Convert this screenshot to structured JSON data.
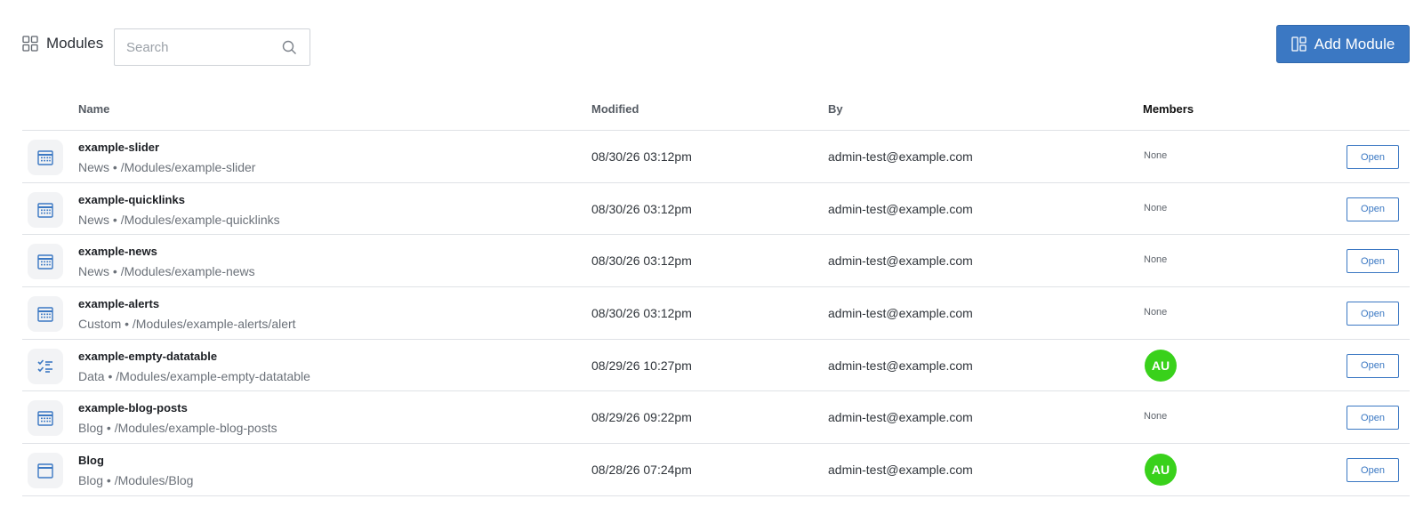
{
  "header": {
    "title": "Modules",
    "search_placeholder": "Search",
    "search_value": "",
    "add_button_label": "Add Module",
    "accent_color": "#3b78c3"
  },
  "table": {
    "columns": {
      "name": "Name",
      "modified": "Modified",
      "by": "By",
      "members": "Members"
    },
    "open_label": "Open",
    "rows": [
      {
        "name": "example-slider",
        "type": "News",
        "path": "/Modules/example-slider",
        "modified": "08/30/26 03:12pm",
        "by": "admin-test@example.com",
        "members": "None",
        "icon": "calendar-grid-icon"
      },
      {
        "name": "example-quicklinks",
        "type": "News",
        "path": "/Modules/example-quicklinks",
        "modified": "08/30/26 03:12pm",
        "by": "admin-test@example.com",
        "members": "None",
        "icon": "calendar-grid-icon"
      },
      {
        "name": "example-news",
        "type": "News",
        "path": "/Modules/example-news",
        "modified": "08/30/26 03:12pm",
        "by": "admin-test@example.com",
        "members": "None",
        "icon": "calendar-grid-icon"
      },
      {
        "name": "example-alerts",
        "type": "Custom",
        "path": "/Modules/example-alerts/alert",
        "modified": "08/30/26 03:12pm",
        "by": "admin-test@example.com",
        "members": "None",
        "icon": "calendar-grid-icon"
      },
      {
        "name": "example-empty-datatable",
        "type": "Data",
        "path": "/Modules/example-empty-datatable",
        "modified": "08/29/26 10:27pm",
        "by": "admin-test@example.com",
        "members": "AU",
        "icon": "checklist-icon"
      },
      {
        "name": "example-blog-posts",
        "type": "Blog",
        "path": "/Modules/example-blog-posts",
        "modified": "08/29/26 09:22pm",
        "by": "admin-test@example.com",
        "members": "None",
        "icon": "calendar-grid-icon"
      },
      {
        "name": "Blog",
        "type": "Blog",
        "path": "/Modules/Blog",
        "modified": "08/28/26 07:24pm",
        "by": "admin-test@example.com",
        "members": "AU",
        "icon": "calendar-icon"
      }
    ]
  },
  "avatar_color": "#39d11b"
}
